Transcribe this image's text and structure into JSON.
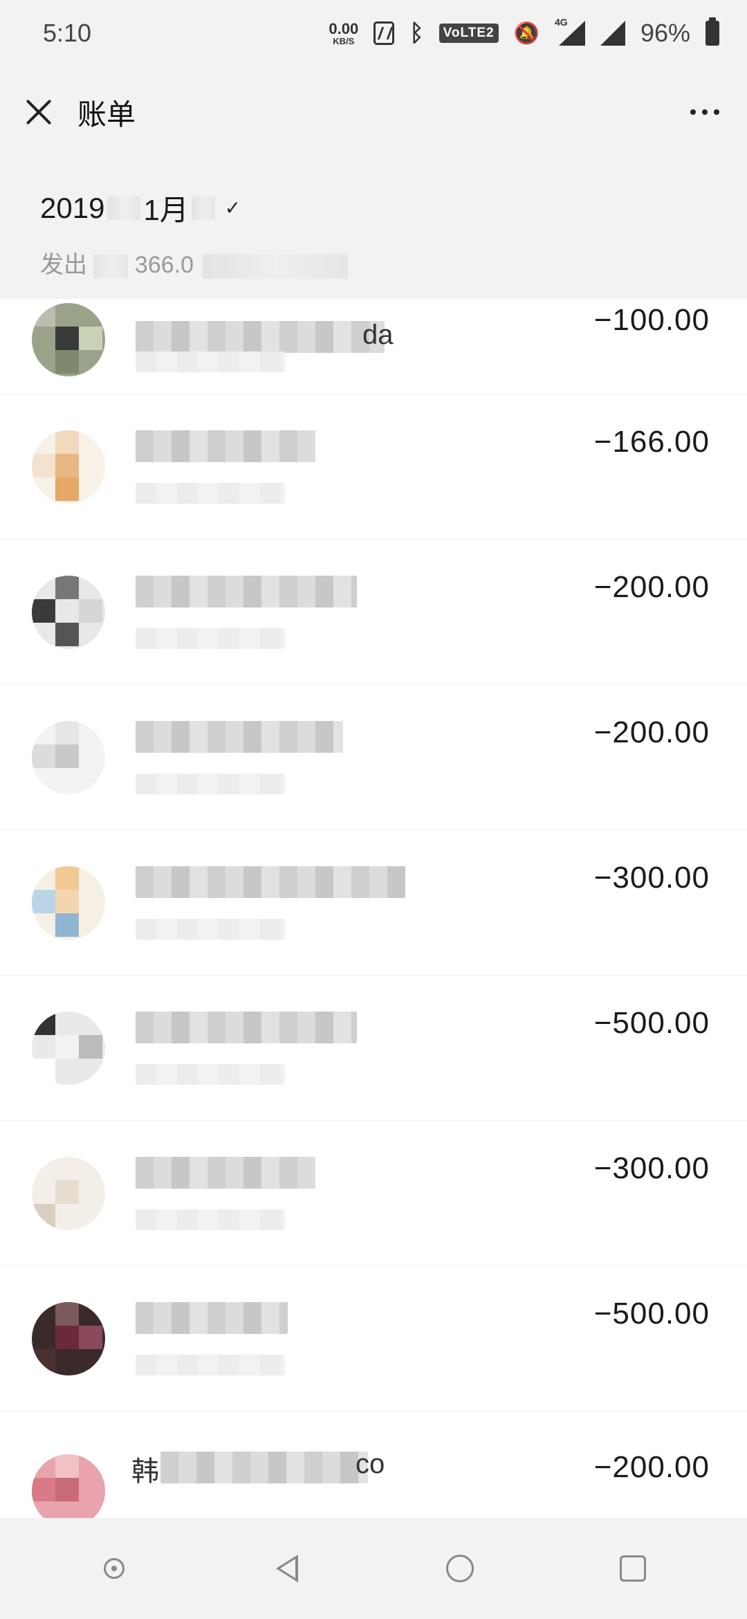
{
  "status_bar": {
    "time": "5:10",
    "net_speed_value": "0.00",
    "net_speed_unit": "KB/S",
    "volte_label": "VoLTE2",
    "signal_label": "4G",
    "battery_percent": "96%",
    "icons": [
      "nfc-icon",
      "bluetooth-icon",
      "volte-icon",
      "mute-bell-icon",
      "signal-4g-icon",
      "signal-icon",
      "battery-icon"
    ]
  },
  "nav": {
    "title": "账单",
    "close_icon": "close-icon",
    "more_icon": "more-icon"
  },
  "month_header": {
    "year_visible": "2019",
    "month_visible": "1月",
    "caret": "✓",
    "summary_prefix": "发出",
    "summary_amount_visible": "366.0"
  },
  "bills": [
    {
      "name_visible": "da",
      "amount": "−100.00"
    },
    {
      "name_visible": "",
      "amount": "−166.00"
    },
    {
      "name_visible": "",
      "amount": "−200.00"
    },
    {
      "name_visible": "",
      "amount": "−200.00"
    },
    {
      "name_visible": "",
      "amount": "−300.00"
    },
    {
      "name_visible": "",
      "amount": "−500.00"
    },
    {
      "name_visible": "",
      "amount": "−300.00"
    },
    {
      "name_visible": "",
      "amount": "−500.00"
    },
    {
      "name_visible": "co",
      "amount": "−200.00",
      "name_prefix_visible": "韩"
    }
  ],
  "system_nav": {
    "keys": [
      "assistant-icon",
      "back-icon",
      "home-icon",
      "recent-apps-icon"
    ]
  },
  "colors": {
    "header_bg": "#f2f2f2",
    "list_bg": "#ffffff",
    "text_primary": "#1a1a1a",
    "text_secondary": "#999999"
  }
}
